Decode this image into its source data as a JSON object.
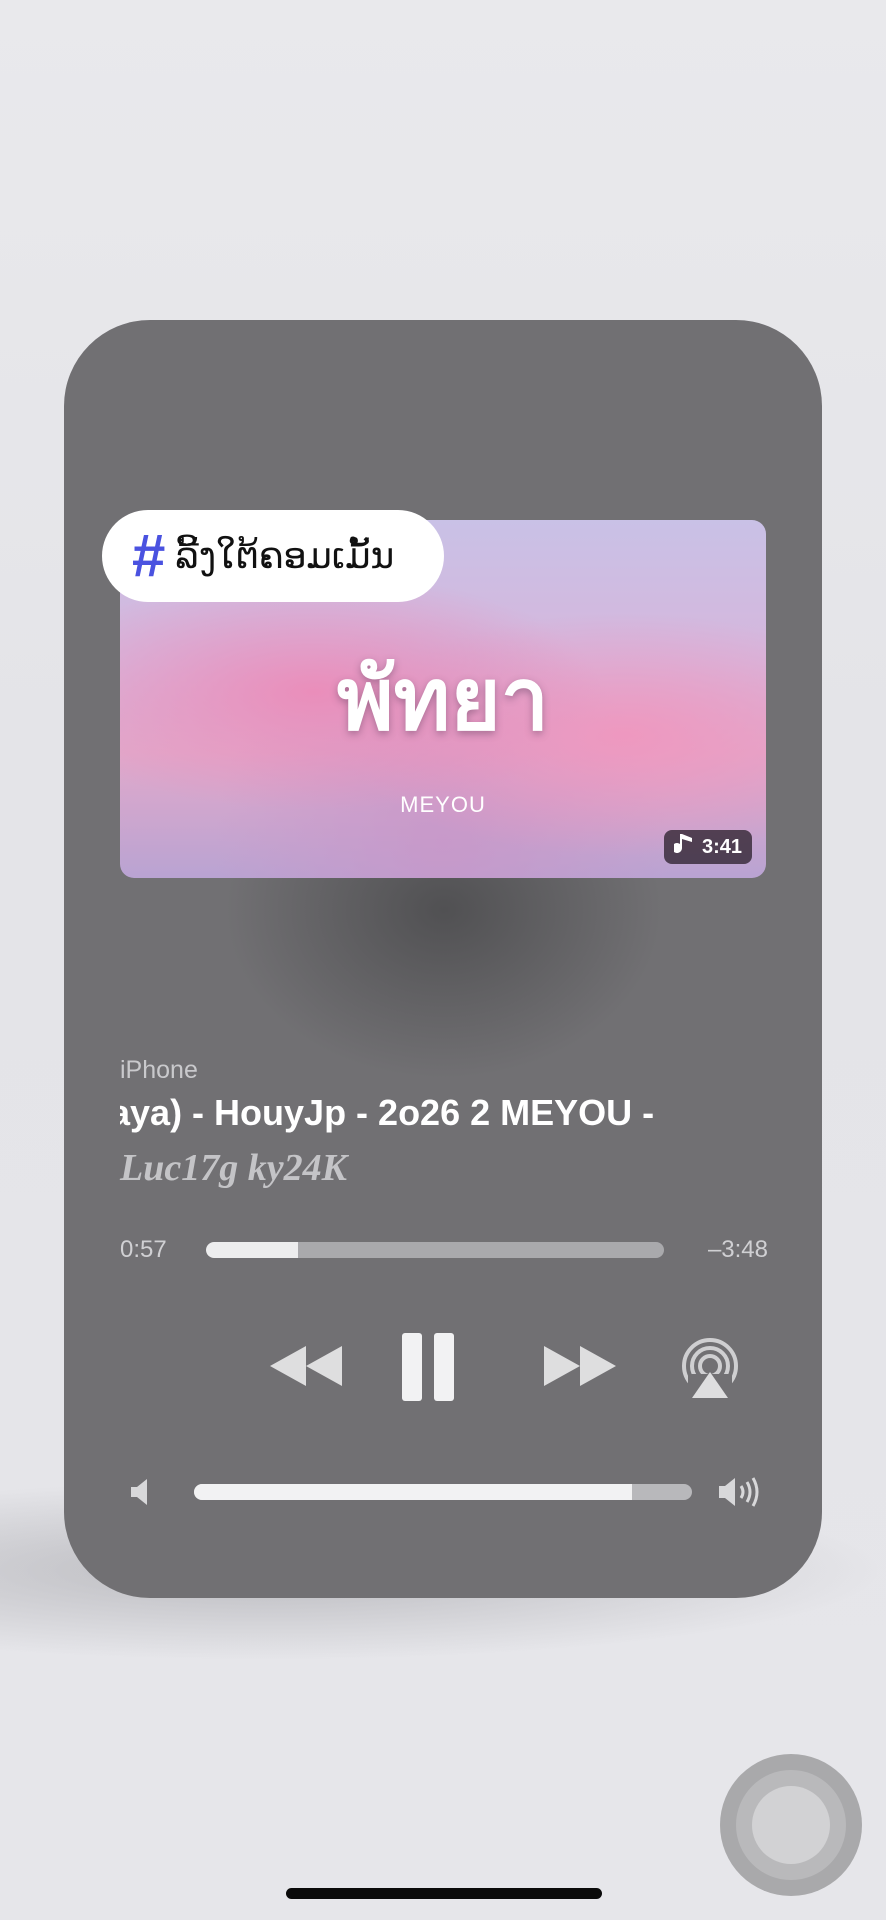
{
  "overlay": {
    "hash_symbol": "#",
    "hashtag_text": "ລີ້ງໃຕ້ຄອມເມັ້ນ"
  },
  "artwork": {
    "title": "พัทยา",
    "artist": "MEYOU",
    "duration": "3:41"
  },
  "now_playing": {
    "device": "iPhone",
    "title": "aya) - HouyJp - 2o26 2      MEYOU -",
    "subtitle": "Luc17g ky24K"
  },
  "progress": {
    "elapsed": "0:57",
    "remaining": "–3:48",
    "fraction": 0.2
  },
  "volume": {
    "level": 0.88
  },
  "colors": {
    "hashtag_accent": "#4a52e0",
    "panel": "#717073"
  },
  "icons": [
    "music-note-icon",
    "rewind-icon",
    "pause-icon",
    "fast-forward-icon",
    "airplay-icon",
    "volume-low-icon",
    "volume-high-icon",
    "assistive-touch-icon"
  ]
}
